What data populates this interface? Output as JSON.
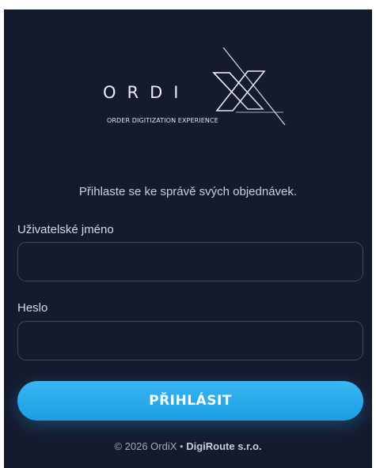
{
  "logo": {
    "wordmark": "ORDI",
    "wordmark_x": "X",
    "tagline": "ORDER DIGITIZATION EXPERIENCE"
  },
  "login": {
    "subtitle": "Přihlaste se ke správě svých objednávek.",
    "username_label": "Uživatelské jméno",
    "username_value": "",
    "password_label": "Heslo",
    "password_value": "",
    "submit_label": "PŘIHLÁSIT"
  },
  "footer": {
    "copyright": "© 2026 OrdiX •",
    "company": "DigiRoute s.r.o."
  },
  "colors": {
    "background": "#151b2d",
    "accent": "#2aa9ec",
    "field_border": "#3e465a"
  }
}
